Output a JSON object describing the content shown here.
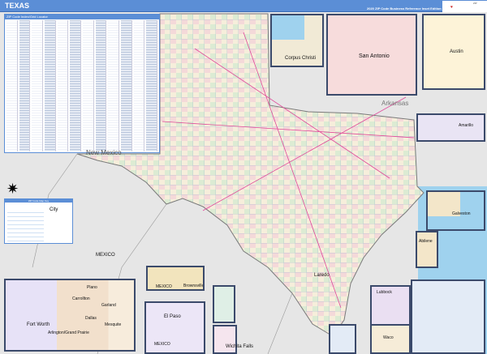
{
  "header": {
    "title": "TEXAS",
    "subtitle": "2020 ZIP Code Business Reference Inset Edition",
    "logo": "Market MAPS"
  },
  "index": {
    "title": "ZIP Code Index/Grid Locator"
  },
  "legend": {
    "title": "ZIP Code Map Key",
    "sample_city": "City"
  },
  "labels": {
    "new_mexico": "New Mexico",
    "mexico": "MEXICO",
    "arkansas": "Arkansas",
    "laredo": "Laredo"
  },
  "insets": [
    {
      "name": "Corpus Christi"
    },
    {
      "name": "San Antonio"
    },
    {
      "name": "Austin"
    },
    {
      "name": "Amarillo"
    },
    {
      "name": "Galveston"
    },
    {
      "name": "Abilene"
    },
    {
      "name": "Lubbock"
    },
    {
      "name": "Waco"
    },
    {
      "name": "Brownsville",
      "region": "MEXICO"
    },
    {
      "name": "El Paso",
      "region": "MEXICO"
    },
    {
      "name": "Wichita Falls"
    },
    {
      "name": "Dallas",
      "cities": [
        "Plano",
        "Carrollton",
        "Garland",
        "Fort Worth",
        "Dallas",
        "Mesquite",
        "Arlington/Grand Prairie"
      ]
    }
  ],
  "colors": {
    "header": "#5b8ed6",
    "inset_border": "#3b4a6b",
    "water": "#9fd2ee"
  }
}
